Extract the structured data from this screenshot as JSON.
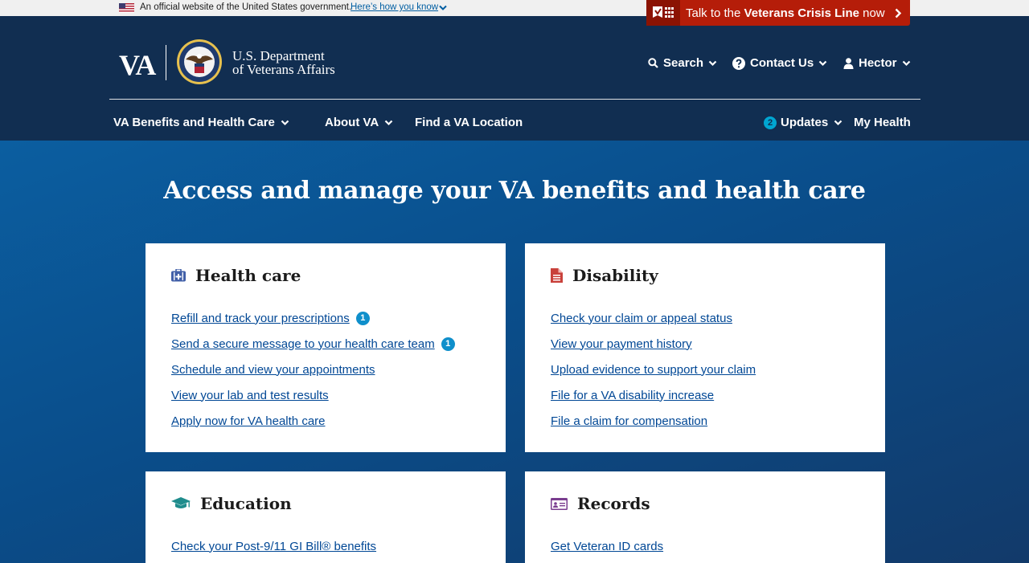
{
  "gov_banner": {
    "official_text": "An official website of the United States government.",
    "how_link": "Here’s how you know"
  },
  "crisis_line": {
    "prefix": "Talk to the ",
    "bold": "Veterans Crisis Line",
    "suffix": " now"
  },
  "header": {
    "logo_short": "VA",
    "dept_line1": "U.S. Department",
    "dept_line2": "of Veterans Affairs",
    "search_label": "Search",
    "contact_label": "Contact Us",
    "user_label": "Hector"
  },
  "nav": {
    "benefits_label": "VA Benefits and Health Care",
    "about_label": "About VA",
    "find_label": "Find a VA Location",
    "updates_count": "2",
    "updates_label": "Updates",
    "myhealth_label": "My Health"
  },
  "hero": {
    "title": "Access and manage your VA benefits and health care"
  },
  "cards": [
    {
      "title": "Health care",
      "icon": "medkit-icon",
      "links": [
        {
          "label": "Refill and track your prescriptions",
          "badge": "1"
        },
        {
          "label": "Send a secure message to your health care team",
          "badge": "1"
        },
        {
          "label": "Schedule and view your appointments"
        },
        {
          "label": "View your lab and test results"
        },
        {
          "label": "Apply now for VA health care"
        }
      ]
    },
    {
      "title": "Disability",
      "icon": "file-text-icon",
      "links": [
        {
          "label": "Check your claim or appeal status"
        },
        {
          "label": "View your payment history"
        },
        {
          "label": "Upload evidence to support your claim"
        },
        {
          "label": "File for a VA disability increase"
        },
        {
          "label": "File a claim for compensation"
        }
      ]
    },
    {
      "title": "Education",
      "icon": "graduation-cap-icon",
      "links": [
        {
          "label": "Check your Post-9/11 GI Bill® benefits"
        }
      ]
    },
    {
      "title": "Records",
      "icon": "id-card-icon",
      "links": [
        {
          "label": "Get Veteran ID cards"
        }
      ]
    }
  ],
  "colors": {
    "header_bg": "#112e51",
    "crisis_red": "#b51d09",
    "link_blue": "#004795",
    "badge_cyan": "#00a6d2"
  }
}
